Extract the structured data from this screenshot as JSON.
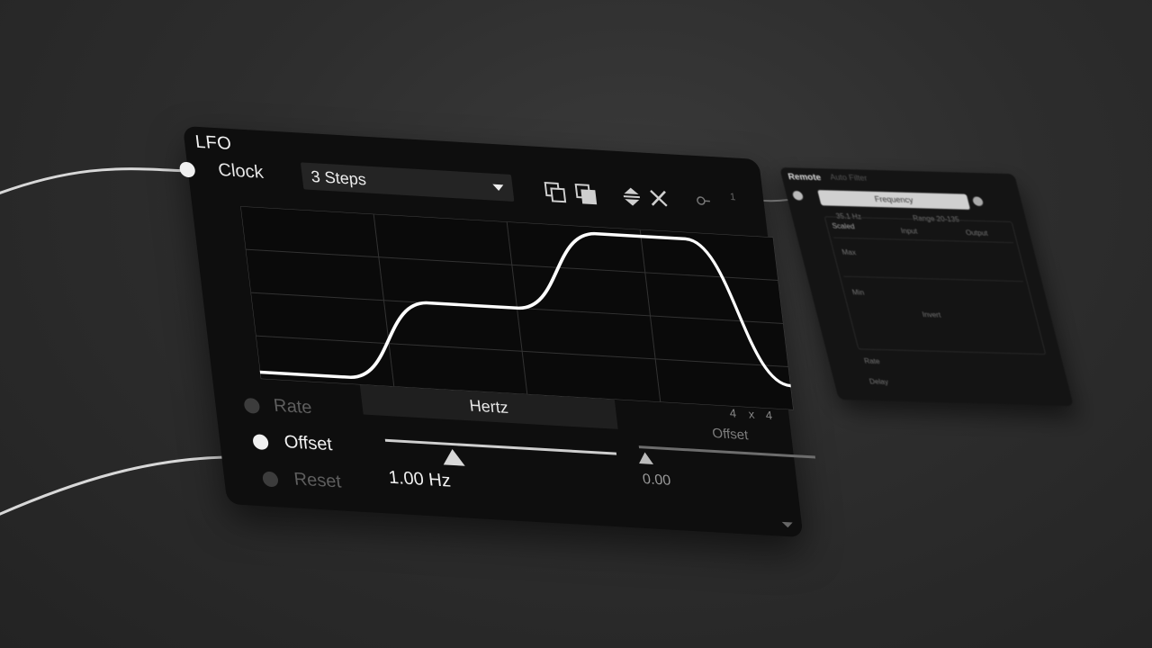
{
  "lfo": {
    "title": "LFO",
    "clock_label": "Clock",
    "clock_value": "3 Steps",
    "rate_label": "Rate",
    "offset_label": "Offset",
    "reset_label": "Reset",
    "rate_unit_button": "Hertz",
    "rate_value": "1.00 Hz",
    "offset_slider_label": "Offset",
    "offset_value": "0.00",
    "grid_cols": "4",
    "grid_x": "x",
    "grid_rows": "4",
    "panel_number": "1",
    "waveform": [
      0.04,
      0.04,
      0.5,
      0.5,
      0.96,
      0.96,
      0.14
    ]
  },
  "remote": {
    "title": "Remote",
    "subtitle": "Auto Filter",
    "target": "Frequency",
    "left_info": "35.1 Hz",
    "right_info": "Range 20-135",
    "scaled_label": "Scaled",
    "input_label": "Input",
    "output_label": "Output",
    "max_label": "Max",
    "min_label": "Min",
    "invert_label": "Invert",
    "rate_label": "Rate",
    "delay_label": "Delay"
  },
  "colors": {
    "background": "#2d2d2d",
    "panel": "#0e0e0e",
    "wave": "#ffffff",
    "port_active": "#f0f0f0",
    "port_inactive": "#3c3c3c"
  }
}
